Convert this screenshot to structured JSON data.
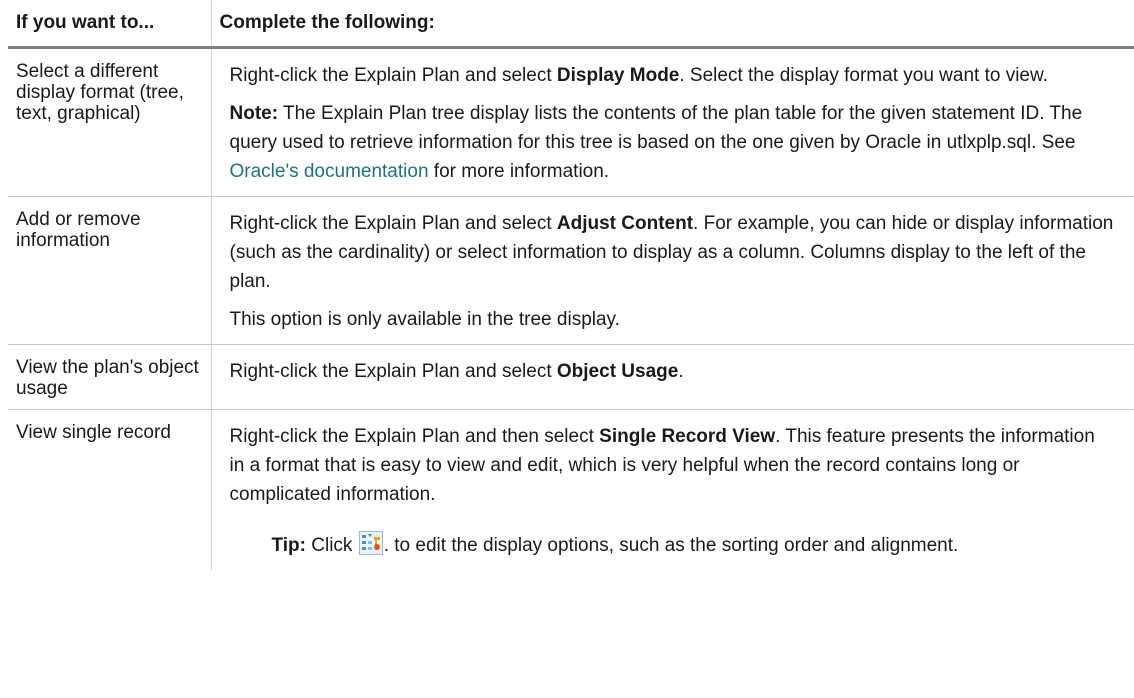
{
  "header": {
    "col1": "If you want to...",
    "col2": "Complete the following:"
  },
  "rows": [
    {
      "want": "Select a different display format (tree, text, graphical)",
      "p1_pre": "Right-click the Explain Plan and select ",
      "p1_bold": "Display Mode",
      "p1_post": ". Select the display format you want to view.",
      "note_label": "Note:",
      "note_pre": " The Explain Plan tree display lists the contents of the plan table for the given statement ID. The query used to retrieve information for this tree is based on the one given by Oracle in utlxplp.sql. See ",
      "note_link": "Oracle's documentation",
      "note_post": " for more information."
    },
    {
      "want": "Add or remove information",
      "p1_pre": "Right-click the Explain Plan and select ",
      "p1_bold": "Adjust Content",
      "p1_post": ". For example, you can hide or display information (such as the cardinality) or select information to display as a column. Columns display to the left of the plan.",
      "p2": "This option is only available in the tree display."
    },
    {
      "want": "View the plan's object usage",
      "p1_pre": "Right-click the Explain Plan and select ",
      "p1_bold": "Object Usage",
      "p1_post": "."
    },
    {
      "want": "View single record",
      "p1_pre": "Right-click the Explain Plan and then select ",
      "p1_bold": "Single Record View",
      "p1_post": ". This feature presents the information in a format that is easy to view and edit, which is very helpful when the record contains long or complicated information.",
      "tip_label": "Tip:",
      "tip_pre": " Click ",
      "tip_icon": "display-options-icon",
      "tip_post": ". to edit the display options, such as the sorting order and alignment."
    }
  ]
}
